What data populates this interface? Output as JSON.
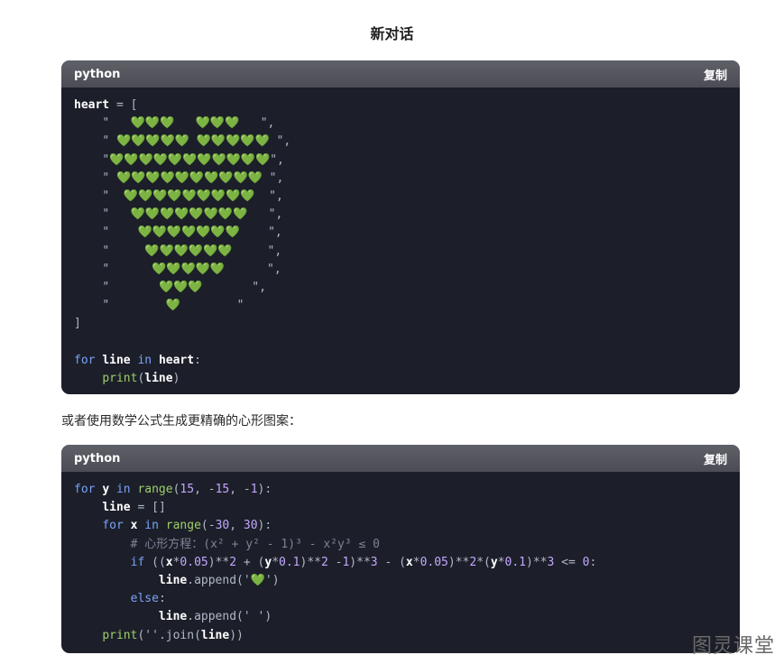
{
  "page": {
    "title": "新对话"
  },
  "code_blocks": [
    {
      "language": "python",
      "copy_label": "复制",
      "lines": [
        "heart = [",
        "    \"   💚💚💚   💚💚💚   \",",
        "    \" 💚💚💚💚💚 💚💚💚💚💚 \",",
        "    \"💚💚💚💚💚💚💚💚💚💚💚\",",
        "    \" 💚💚💚💚💚💚💚💚💚💚 \",",
        "    \"  💚💚💚💚💚💚💚💚💚  \",",
        "    \"   💚💚💚💚💚💚💚💚   \",",
        "    \"    💚💚💚💚💚💚💚    \",",
        "    \"     💚💚💚💚💚💚     \",",
        "    \"      💚💚💚💚💚      \",",
        "    \"       💚💚💚       \",",
        "    \"        💚        \"",
        "]",
        "",
        "for line in heart:",
        "    print(line)"
      ]
    },
    {
      "language": "python",
      "copy_label": "复制",
      "lines": [
        "for y in range(15, -15, -1):",
        "    line = []",
        "    for x in range(-30, 30):",
        "        # 心形方程：(x² + y² - 1)³ - x²y³ ≤ 0",
        "        if ((x*0.05)**2 + (y*0.1)**2 -1)**3 - (x*0.05)**2*(y*0.1)**3 <= 0:",
        "            line.append('💚')",
        "        else:",
        "            line.append(' ')",
        "    print(''.join(line))"
      ]
    }
  ],
  "paragraph": "或者使用数学公式生成更精确的心形图案：",
  "watermark": "图灵课堂",
  "colors": {
    "code_bg": "#1c1f29",
    "header_bg": "#55565e",
    "keyword": "#7aa2f7",
    "function": "#9ece6a",
    "heart": "#93c47d"
  }
}
